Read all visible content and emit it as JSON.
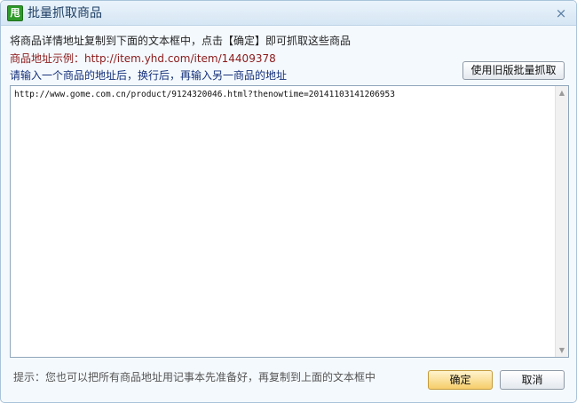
{
  "window": {
    "title": "批量抓取商品",
    "app_icon_label": "甩",
    "close_glyph": "×"
  },
  "instructions": {
    "line1": "将商品详情地址复制到下面的文本框中，点击【确定】即可抓取这些商品",
    "line2": "商品地址示例：http://item.yhd.com/item/14409378",
    "line3": "请输入一个商品的地址后，换行后，再输入另一商品的地址"
  },
  "buttons": {
    "legacy_label": "使用旧版批量抓取",
    "ok_label": "确定",
    "cancel_label": "取消"
  },
  "url_input": {
    "value": "http://www.gome.com.cn/product/9124320046.html?thenowtime=20141103141206953"
  },
  "hint": "提示：您也可以把所有商品地址用记事本先准备好，再复制到上面的文本框中",
  "icons": {
    "scroll_up": "▲",
    "scroll_down": "▼"
  },
  "colors": {
    "example_text": "#8b1a1a",
    "instruction_text": "#15307a",
    "ok_button": "#f6cd6b"
  }
}
